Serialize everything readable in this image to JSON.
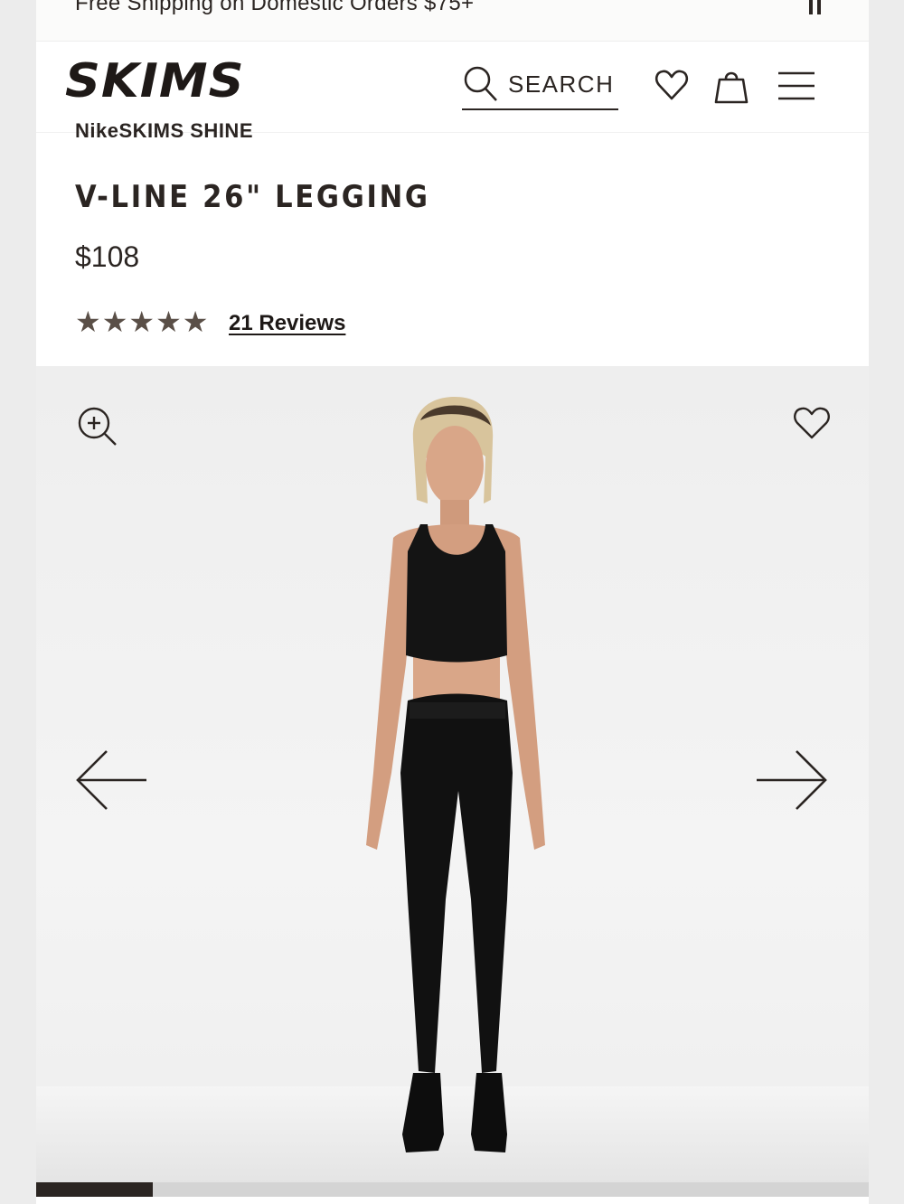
{
  "announcement": {
    "text": "Free Shipping on Domestic Orders $75+",
    "pause_icon": "pause-icon"
  },
  "header": {
    "logo": "SKIMS",
    "search_label": "SEARCH",
    "icons": [
      "search-icon",
      "heart-icon",
      "bag-icon",
      "menu-icon"
    ]
  },
  "product": {
    "collection": "NikeSKIMS SHINE",
    "title": "V-LINE 26\" LEGGING",
    "price": "$108",
    "rating": 5,
    "reviews_label": "21 Reviews"
  },
  "gallery": {
    "icons": [
      "zoom-in-icon",
      "heart-icon",
      "arrow-left-icon",
      "arrow-right-icon"
    ],
    "progress": 0.14
  },
  "colors": {
    "text": "#2b2522",
    "star": "#5a4f47",
    "background": "#ececec"
  }
}
